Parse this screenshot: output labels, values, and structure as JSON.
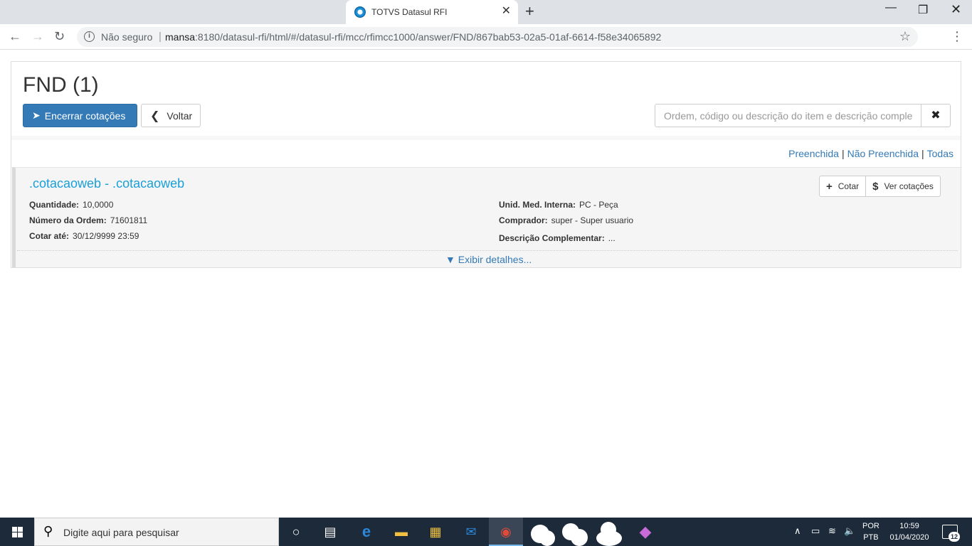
{
  "browser": {
    "tab_title": "TOTVS Datasul RFI",
    "security_label": "Não seguro",
    "url_host": "mansa",
    "url_rest": ":8180/datasul-rfi/html/#/datasul-rfi/mcc/rfimcc1000/answer/FND/867bab53-02a5-01af-6614-f58e34065892"
  },
  "page": {
    "title": "FND (1)",
    "close_quotes_label": "Encerrar cotações",
    "back_label": "Voltar",
    "search_placeholder": "Ordem, código ou descrição do item e descrição complementar",
    "filters": {
      "filled": "Preenchida",
      "not_filled": "Não Preenchida",
      "all": "Todas",
      "separator": "|"
    }
  },
  "item": {
    "title": ".cotacaoweb - .cotacaoweb",
    "quote_label": "Cotar",
    "view_quotes_label": "Ver cotações",
    "quantity_label": "Quantidade:",
    "quantity_value": "10,0000",
    "order_label": "Número da Ordem:",
    "order_value": "71601811",
    "quote_until_label": "Cotar até:",
    "quote_until_value": "30/12/9999 23:59",
    "unit_label": "Unid. Med. Interna:",
    "unit_value": "PC - Peça",
    "buyer_label": "Comprador:",
    "buyer_value": "super - Super usuario",
    "desc_label": "Descrição Complementar:",
    "desc_value": "...",
    "details_label": "▼ Exibir detalhes..."
  },
  "taskbar": {
    "search_text": "Digite aqui para pesquisar",
    "lang_top": "POR",
    "lang_bottom": "PTB",
    "time": "10:59",
    "date": "01/04/2020",
    "notification_count": "12"
  }
}
